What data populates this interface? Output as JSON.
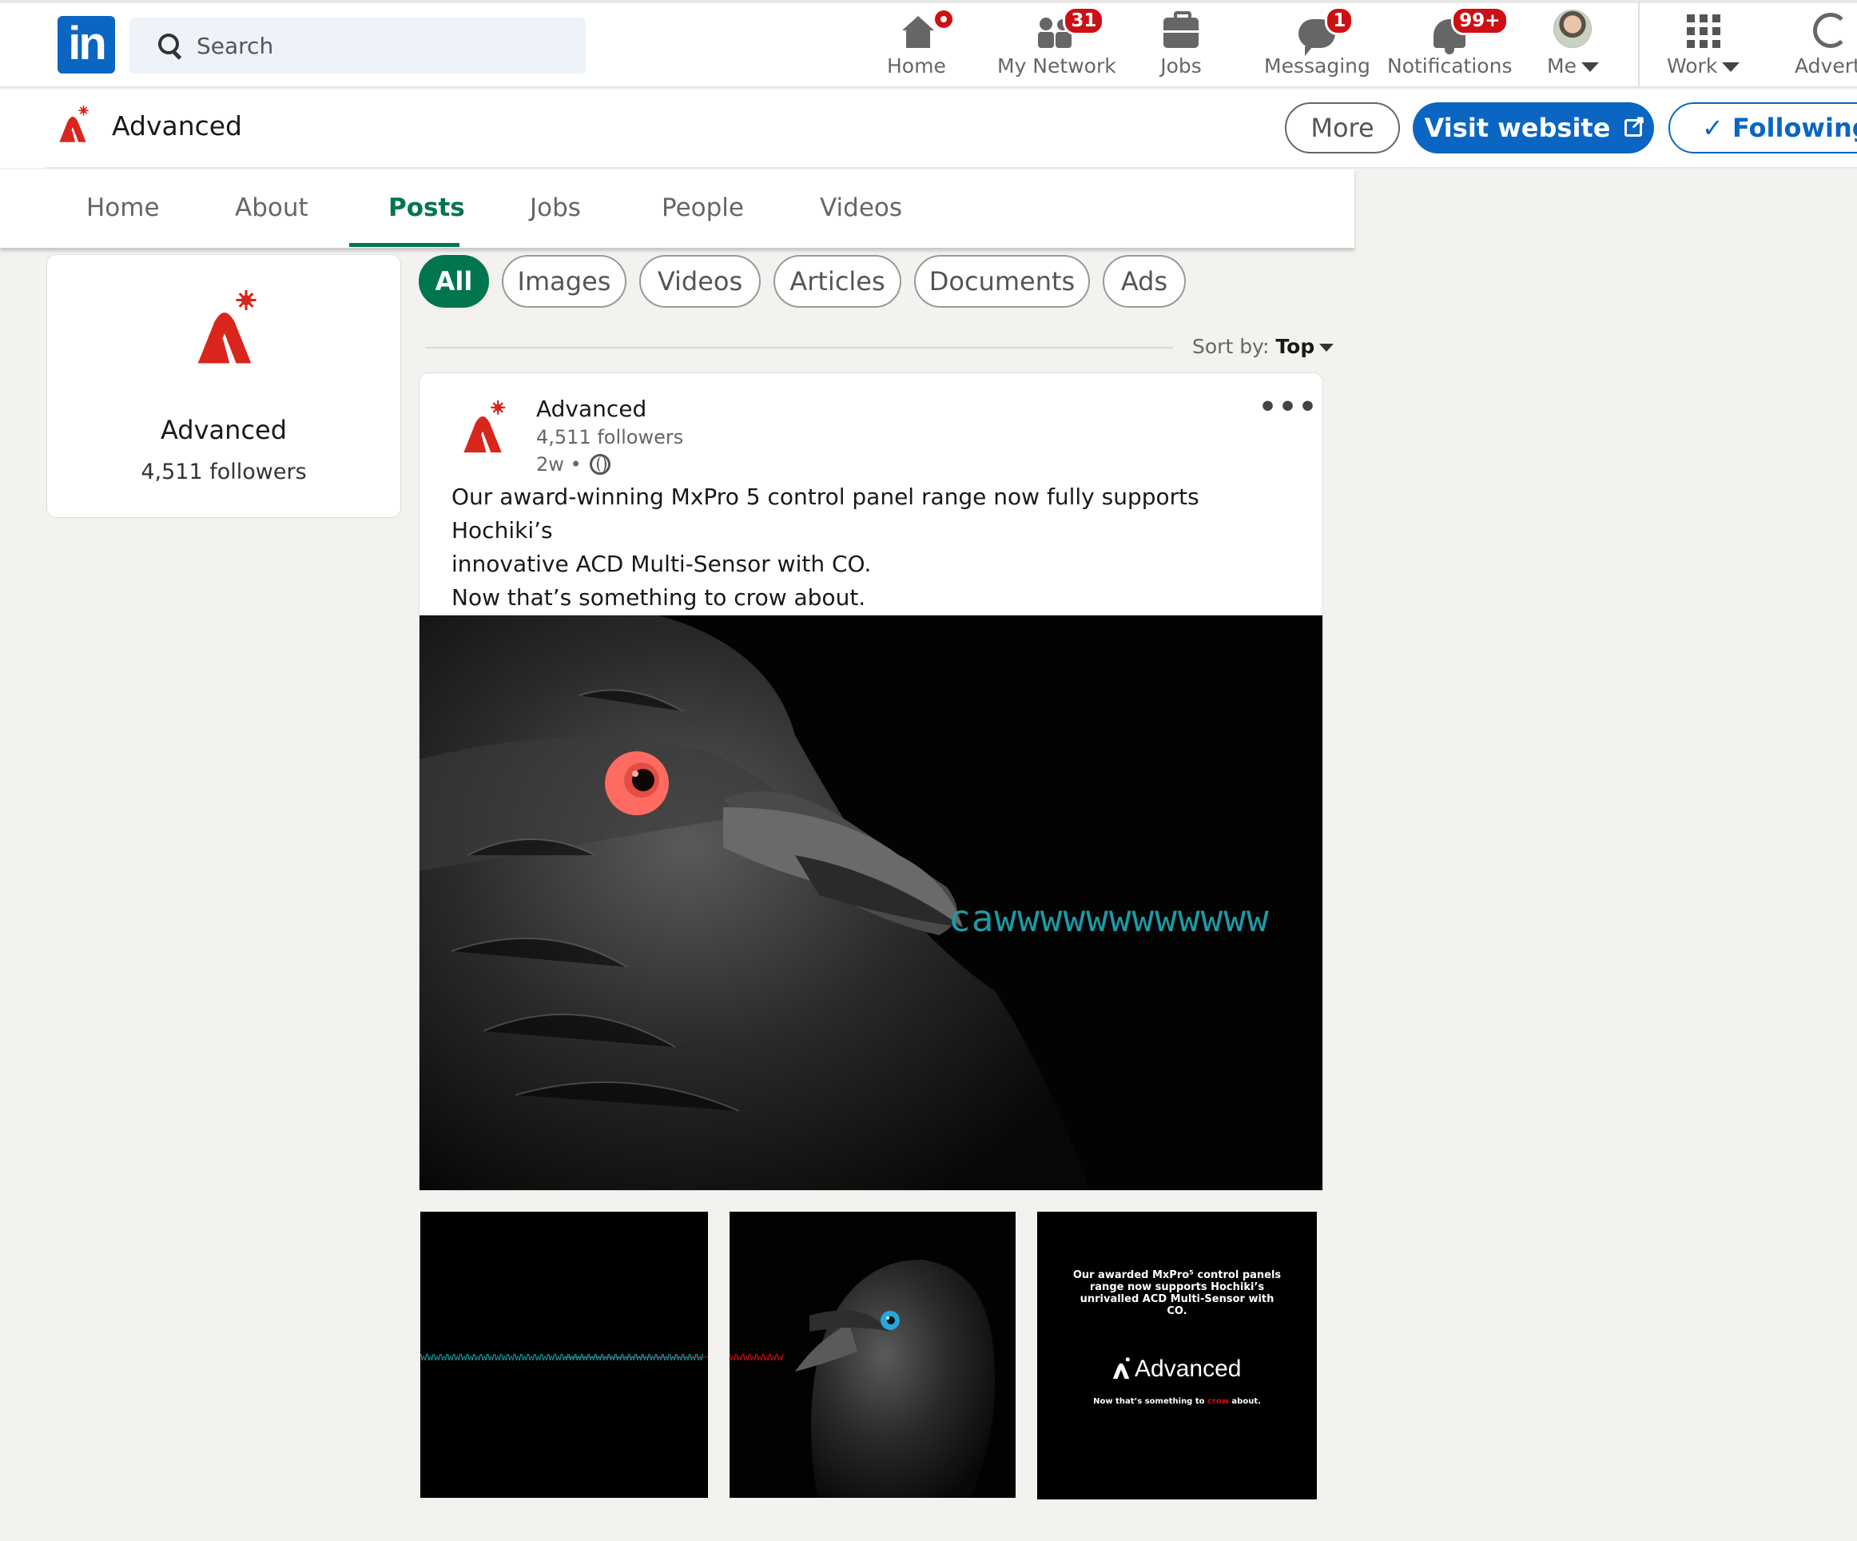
{
  "topnav": {
    "logo": "in",
    "search_placeholder": "Search",
    "items": [
      {
        "label": "Home"
      },
      {
        "label": "My Network",
        "badge": "31"
      },
      {
        "label": "Jobs"
      },
      {
        "label": "Messaging",
        "badge": "1"
      },
      {
        "label": "Notifications",
        "badge": "99+"
      },
      {
        "label": "Me"
      },
      {
        "label": "Work"
      },
      {
        "label": "Adverti"
      }
    ]
  },
  "company": {
    "name": "Advanced",
    "followers": "4,511 followers",
    "brand_color": "#d9261c",
    "buttons": {
      "more": "More",
      "visit": "Visit website",
      "following": "✓ Following"
    },
    "tabs": [
      "Home",
      "About",
      "Posts",
      "Jobs",
      "People",
      "Videos"
    ],
    "active_tab": "Posts"
  },
  "filters": {
    "pills": [
      "All",
      "Images",
      "Videos",
      "Articles",
      "Documents",
      "Ads"
    ],
    "active": "All",
    "sort_label": "Sort by:",
    "sort_value": "Top"
  },
  "post": {
    "author": "Advanced",
    "followers": "4,511 followers",
    "time": "2w •",
    "more": "•••",
    "text_lines": [
      "Our award-winning MxPro 5 control panel range now fully supports Hochiki’s",
      "innovative ACD Multi-Sensor with CO.",
      "Now that’s something to crow about."
    ],
    "hero_caption": "cawwwwwwwwwwww",
    "thumb1_caw": "wwwwwwwwwwwwwwwwwwwwwwwwwwwwwwwwwwwwwwwwww",
    "thumb2_caw": "wwwwwwww",
    "thumb3": {
      "copy": "Our awarded MxPro⁵ control panels range now supports Hochiki’s unrivalled ACD Multi-Sensor with CO.",
      "brand": "Advanced",
      "tag_before": "Now that’s something to ",
      "tag_crow": "crow",
      "tag_after": " about."
    }
  },
  "colors": {
    "linkedin_blue": "#0a66c2",
    "active_green": "#01754f",
    "caw_teal": "#1c9aa6",
    "badge_red": "#cc1016"
  }
}
